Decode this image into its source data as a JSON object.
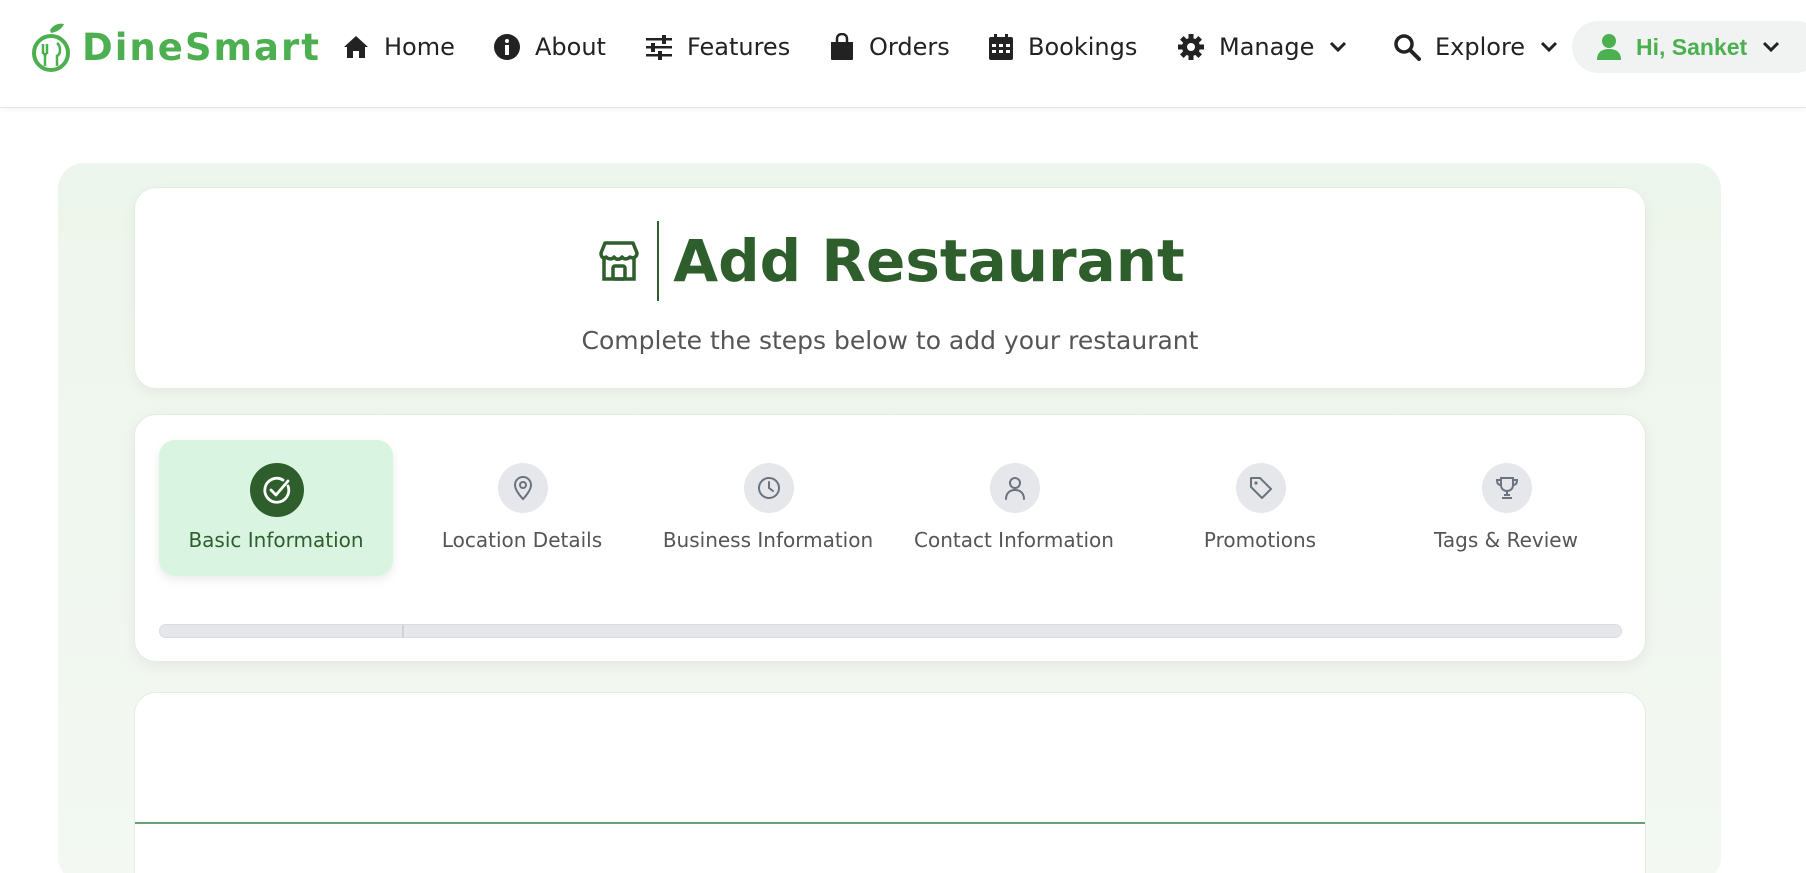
{
  "brand": {
    "name": "DineSmart"
  },
  "nav": {
    "items": [
      {
        "label": "Home",
        "icon": "home-icon"
      },
      {
        "label": "About",
        "icon": "info-icon"
      },
      {
        "label": "Features",
        "icon": "sliders-icon"
      },
      {
        "label": "Orders",
        "icon": "shopping-bag-icon"
      },
      {
        "label": "Bookings",
        "icon": "calendar-icon"
      },
      {
        "label": "Manage",
        "icon": "gear-icon",
        "dropdown": true
      },
      {
        "label": "Explore",
        "icon": "search-icon",
        "dropdown": true
      }
    ],
    "user": {
      "greeting": "Hi, Sanket",
      "icon": "user-icon"
    }
  },
  "header": {
    "title": "Add Restaurant",
    "subtitle": "Complete the steps below to add your restaurant",
    "icon": "store-icon"
  },
  "steps": {
    "items": [
      {
        "label": "Basic Information",
        "icon": "check-circle-icon",
        "active": true
      },
      {
        "label": "Location Details",
        "icon": "map-pin-icon",
        "active": false
      },
      {
        "label": "Business Information",
        "icon": "clock-icon",
        "active": false
      },
      {
        "label": "Contact Information",
        "icon": "person-icon",
        "active": false
      },
      {
        "label": "Promotions",
        "icon": "tag-icon",
        "active": false
      },
      {
        "label": "Tags & Review",
        "icon": "trophy-icon",
        "active": false
      }
    ],
    "progress_percent": 16.7
  },
  "colors": {
    "brand_green": "#4caf50",
    "dark_green": "#2e5e2c",
    "active_step_bg": "#d9f5e1",
    "inactive_circle": "#e5e7eb"
  }
}
